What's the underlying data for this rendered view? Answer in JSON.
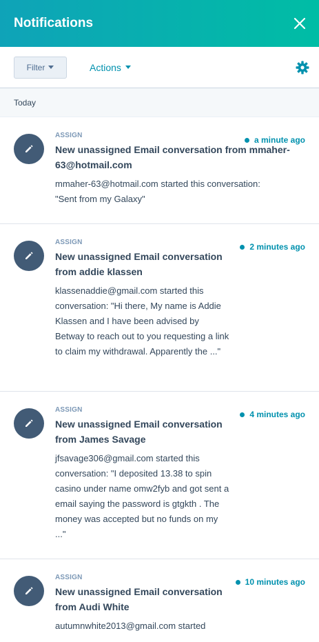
{
  "header": {
    "title": "Notifications"
  },
  "toolbar": {
    "filter_label": "Filter",
    "actions_label": "Actions"
  },
  "section": {
    "label": "Today"
  },
  "notifications": [
    {
      "category": "ASSIGN",
      "time": "a minute ago",
      "title": "New unassigned Email conversation from mmaher-63@hotmail.com",
      "body": "mmaher-63@hotmail.com started this conversation: \"Sent from my Galaxy\""
    },
    {
      "category": "ASSIGN",
      "time": "2 minutes ago",
      "title": "New unassigned Email conversation from addie klassen",
      "body": "klassenaddie@gmail.com started this conversation: \"Hi there, My name is Addie Klassen and I have been advised by Betway to reach out to you requesting a link to claim my withdrawal. Apparently the ...\""
    },
    {
      "category": "ASSIGN",
      "time": "4 minutes ago",
      "title": "New unassigned Email conversation from James Savage",
      "body": "jfsavage306@gmail.com started this conversation: \"I deposited 13.38 to spin casino under name omw2fyb and got sent a email saying the password is gtgkth . The money was accepted but no funds on my ...\""
    },
    {
      "category": "ASSIGN",
      "time": "10 minutes ago",
      "title": "New unassigned Email conversation from Audi White",
      "body": "autumnwhite2013@gmail.com started"
    }
  ],
  "colors": {
    "header_gradient_start": "#0fa3b8",
    "header_gradient_end": "#00bda5",
    "accent": "#0091ae",
    "avatar": "#425b76"
  },
  "icons": {
    "close": "close-icon",
    "settings": "gear-icon",
    "avatar": "pencil-icon",
    "unread": "unread-dot-icon"
  }
}
